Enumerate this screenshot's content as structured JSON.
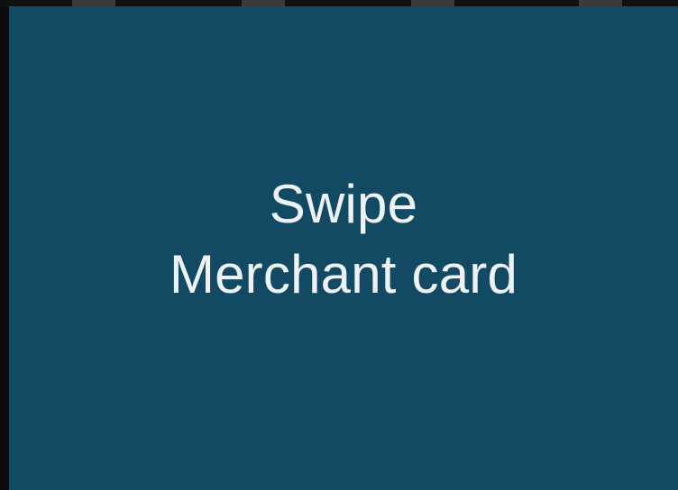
{
  "screen": {
    "background_color": "#124a63",
    "text_color": "#eef2f4",
    "prompt": {
      "line1": "Swipe",
      "line2": "Merchant card"
    }
  }
}
